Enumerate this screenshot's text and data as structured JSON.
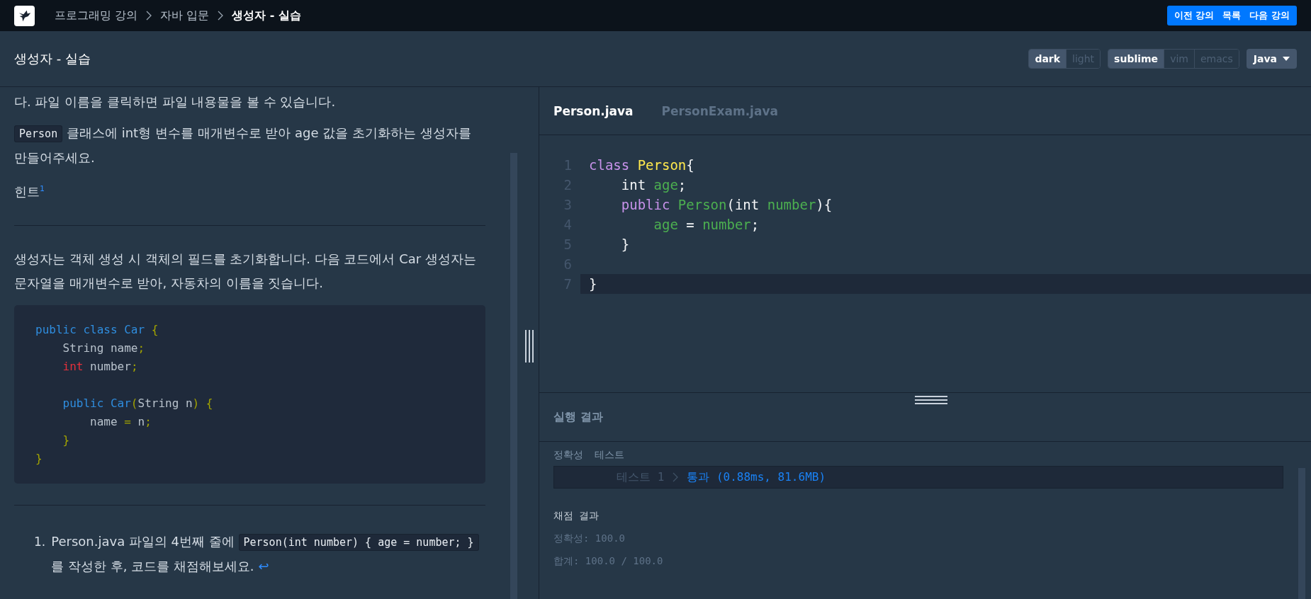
{
  "top_bar": {
    "breadcrumbs": [
      {
        "label": "프로그래밍 강의",
        "current": false
      },
      {
        "label": "자바 입문",
        "current": false
      },
      {
        "label": "생성자 - 실습",
        "current": true
      }
    ],
    "nav_buttons": [
      "이전 강의",
      "목록",
      "다음 강의"
    ]
  },
  "header": {
    "title": "생성자 - 실습",
    "theme_options": [
      {
        "label": "dark",
        "selected": true
      },
      {
        "label": "light",
        "selected": false
      }
    ],
    "keymap_options": [
      {
        "label": "sublime",
        "selected": true
      },
      {
        "label": "vim",
        "selected": false
      },
      {
        "label": "emacs",
        "selected": false
      }
    ],
    "language": "Java"
  },
  "lesson": {
    "blocks": [
      {
        "kind": "paragraph",
        "segments": [
          {
            "kind": "text",
            "text": "다. 파일 이름을 클릭하면 파일 내용물을 볼 수 있습니다."
          }
        ]
      },
      {
        "kind": "paragraph",
        "segments": [
          {
            "kind": "code",
            "text": "Person"
          },
          {
            "kind": "text",
            "text": " 클래스에 int형 변수를 매개변수로 받아 age 값을 초기화하는 생성자를 만들어주세요."
          }
        ]
      },
      {
        "kind": "hint",
        "text": "힌트",
        "footnote": "1"
      },
      {
        "kind": "rule"
      },
      {
        "kind": "paragraph",
        "segments": [
          {
            "kind": "text",
            "text": "생성자는 객체 생성 시 객체의 필드를 초기화합니다. 다음 코드에서 Car 생성자는 문자열을 매개변수로 받아, 자동차의 이름을 짓습니다."
          }
        ]
      },
      {
        "kind": "code_block",
        "groups": [
          [
            [
              {
                "kind": "keyword",
                "text": "public class Car"
              },
              {
                "kind": "punct",
                "text": " {"
              }
            ],
            [
              {
                "kind": "plain",
                "text": "    String name"
              },
              {
                "kind": "punct",
                "text": ";"
              }
            ],
            [
              {
                "kind": "type",
                "text": "    int"
              },
              {
                "kind": "plain",
                "text": " number"
              },
              {
                "kind": "punct",
                "text": ";"
              }
            ]
          ],
          [
            [
              {
                "kind": "keyword",
                "text": "    public Car"
              },
              {
                "kind": "punct",
                "text": "("
              },
              {
                "kind": "plain",
                "text": "String n"
              },
              {
                "kind": "punct",
                "text": ") {"
              }
            ],
            [
              {
                "kind": "plain",
                "text": "        name "
              },
              {
                "kind": "punct",
                "text": "="
              },
              {
                "kind": "plain",
                "text": " n"
              },
              {
                "kind": "punct",
                "text": ";"
              }
            ],
            [
              {
                "kind": "punct",
                "text": "    }"
              }
            ],
            [
              {
                "kind": "punct",
                "text": "}"
              }
            ]
          ]
        ]
      },
      {
        "kind": "rule"
      },
      {
        "kind": "list_item",
        "number": "1.",
        "segments": [
          {
            "kind": "text",
            "text": "Person.java 파일의 4번째 줄에 "
          },
          {
            "kind": "code",
            "text": "Person(int number) { age = number; }"
          },
          {
            "kind": "text",
            "text": " 를 작성한 후, 코드를 채점해보세요."
          }
        ],
        "backref": "↩"
      }
    ]
  },
  "editor": {
    "tabs": [
      {
        "label": "Person.java",
        "selected": true
      },
      {
        "label": "PersonExam.java",
        "selected": false
      }
    ],
    "lines": [
      {
        "number": "1",
        "current": false,
        "tokens": [
          {
            "kind": "keyword",
            "text": "class "
          },
          {
            "kind": "class",
            "text": "Person"
          },
          {
            "kind": "plain",
            "text": "{"
          }
        ]
      },
      {
        "number": "2",
        "current": false,
        "tokens": [
          {
            "kind": "plain",
            "text": "    int "
          },
          {
            "kind": "name",
            "text": "age"
          },
          {
            "kind": "plain",
            "text": ";"
          }
        ]
      },
      {
        "number": "3",
        "current": false,
        "tokens": [
          {
            "kind": "keyword",
            "text": "    public "
          },
          {
            "kind": "name",
            "text": "Person"
          },
          {
            "kind": "plain",
            "text": "(int "
          },
          {
            "kind": "name",
            "text": "number"
          },
          {
            "kind": "plain",
            "text": "){"
          }
        ]
      },
      {
        "number": "4",
        "current": false,
        "tokens": [
          {
            "kind": "name",
            "text": "        age"
          },
          {
            "kind": "plain",
            "text": " = "
          },
          {
            "kind": "name",
            "text": "number"
          },
          {
            "kind": "plain",
            "text": ";"
          }
        ]
      },
      {
        "number": "5",
        "current": false,
        "tokens": [
          {
            "kind": "plain",
            "text": "    }"
          }
        ]
      },
      {
        "number": "6",
        "current": false
      },
      {
        "number": "7",
        "current": true,
        "tokens": [
          {
            "kind": "plain",
            "text": "}"
          }
        ]
      }
    ]
  },
  "results": {
    "title": "실행 결과",
    "section_labels": [
      "정확성",
      "테스트"
    ],
    "tests": [
      {
        "name": "테스트 1",
        "outcome": "통과 (0.88ms, 81.6MB)"
      }
    ],
    "grading_title": "채점 결과",
    "grading_lines": [
      "정확성: 100.0",
      "합계: 100.0 / 100.0"
    ]
  }
}
